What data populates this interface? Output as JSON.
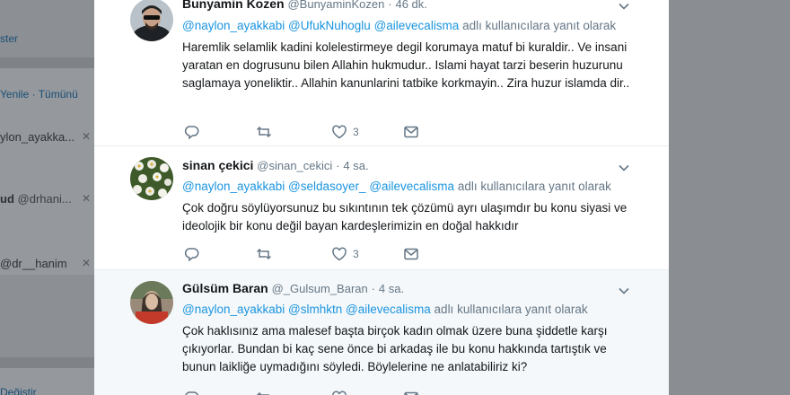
{
  "left_panel": {
    "ster_text": "ster",
    "refresh_label": "Yenile",
    "separator": " · ",
    "all_label": "Tümünü",
    "items": [
      {
        "label": "ylon_ayakka..."
      },
      {
        "label_bold": "ud",
        "label_handle": "@drhani..."
      },
      {
        "label": "@dr__hanim"
      }
    ],
    "change_label": "Değiştir"
  },
  "tweets": [
    {
      "name": "Bunyamin Kozen",
      "handle": "@BunyaminKozen",
      "dot": "·",
      "time": "46 dk.",
      "mentions": [
        "@naylon_ayakkabi",
        "@UfukNuhoglu",
        "@ailevecalisma"
      ],
      "reply_suffix": "adlı kullanıcılara yanıt olarak",
      "text": "Haremlik selamlik kadini kolelestirmeye degil korumaya matuf bi kuraldir.. Ve insani yaratan en dogrusunu bilen Allahin hukmudur.. Islami hayat tarzi beserin huzurunu saglamaya yoneliktir.. Allahin kanunlarini tatbike korkmayin.. Zira huzur islamda dir..",
      "like_count": "3"
    },
    {
      "name": "sinan çekici",
      "handle": "@sinan_cekici",
      "dot": "·",
      "time": "4 sa.",
      "mentions": [
        "@naylon_ayakkabi",
        "@seldasoyer_",
        "@ailevecalisma"
      ],
      "reply_suffix": "adlı kullanıcılara yanıt olarak",
      "text": "Çok doğru söylüyorsunuz bu sıkıntının tek çözümü ayrı ulaşımdır bu konu siyasi ve ideolojik bir konu değil bayan kardeşlerimizin en doğal hakkıdır",
      "like_count": "3"
    },
    {
      "name": "Gülsüm Baran",
      "handle": "@_Gulsum_Baran",
      "dot": "·",
      "time": "4 sa.",
      "mentions": [
        "@naylon_ayakkabi",
        "@slmhktn",
        "@ailevecalisma"
      ],
      "reply_suffix": "adlı kullanıcılara yanıt olarak",
      "text": "Çok haklısınız ama malesef başta birçok kadın olmak üzere buna şiddetle karşı çıkıyorlar. Bundan bi kaç sene önce bi arkadaş ile bu konu hakkında tartıştık ve bunun laikliğe uymadığını söyledi. Böylelerine ne anlatabiliriz ki?",
      "like_count": ""
    }
  ],
  "colors": {
    "mention": "#1b95e0",
    "muted": "#657786",
    "text": "#14171a",
    "overlay": "#8a8d91"
  },
  "icons": [
    "reply-icon",
    "retweet-icon",
    "like-icon",
    "dm-icon",
    "chevron-down-icon",
    "close-icon"
  ]
}
